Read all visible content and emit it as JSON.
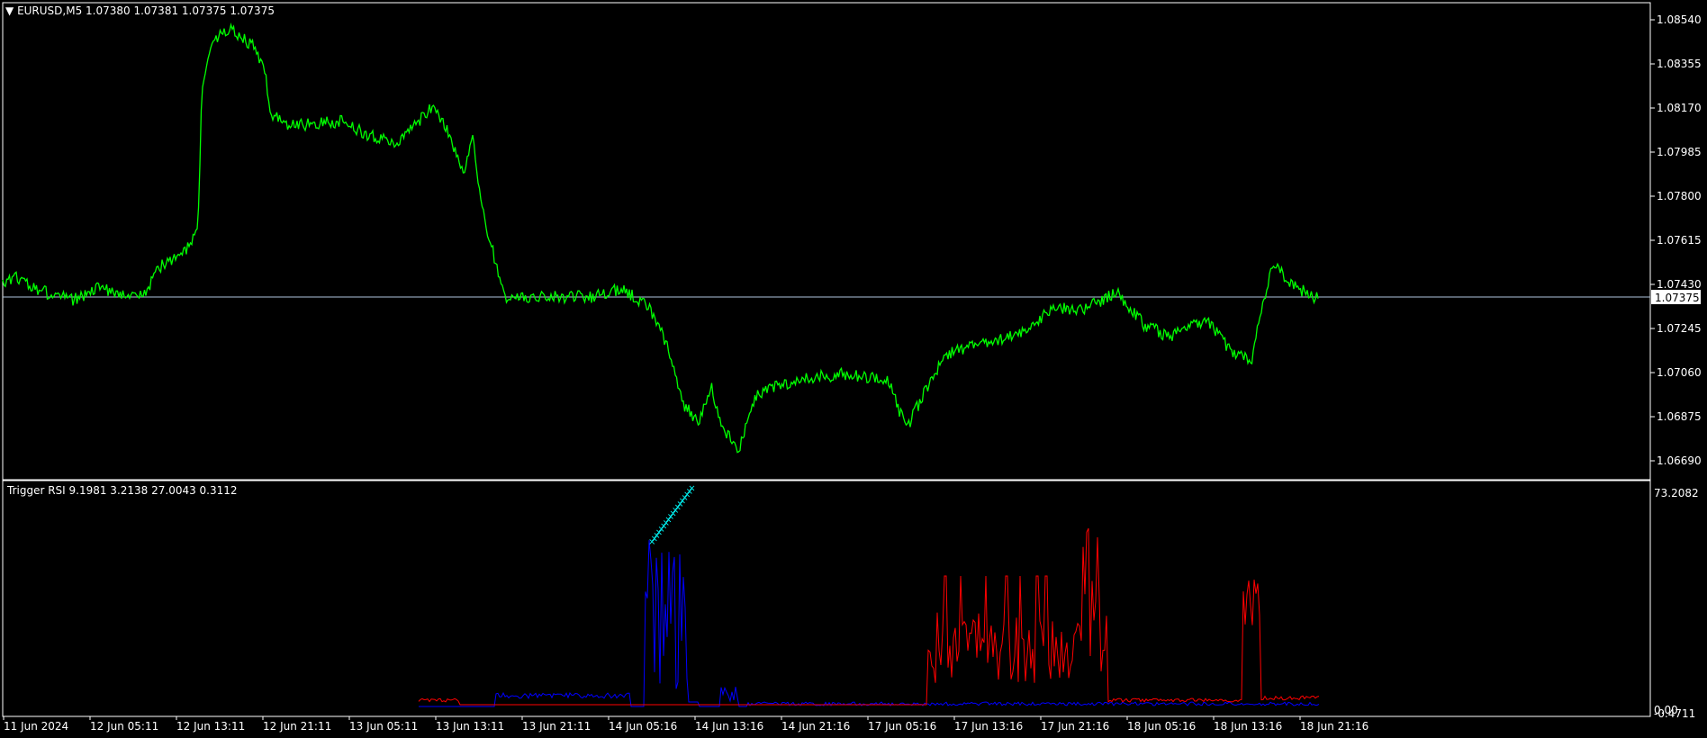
{
  "main_title": "EURUSD,M5  1.07380 1.07381 1.07375 1.07375",
  "indicator_title": "Trigger RSI 9.1981 3.2138 27.0043 0.3112",
  "current_price_label": "1.07375",
  "colors": {
    "background": "#000000",
    "frame": "#ffffff",
    "price": "#00ff00",
    "current_line": "#b0c4de",
    "rsi_red": "#ff0000",
    "rsi_blue": "#0000ff",
    "markers": "#00ffff"
  },
  "chart_data": [
    {
      "type": "line",
      "name": "price",
      "ylim": [
        1.066,
        1.086
      ],
      "y_ticks": [
        "1.08540",
        "1.08355",
        "1.08170",
        "1.07985",
        "1.07800",
        "1.07615",
        "1.07430",
        "1.07245",
        "1.07060",
        "1.06875",
        "1.06690"
      ],
      "current_value": 1.07375,
      "x_ticks": [
        "11 Jun 2024",
        "12 Jun 05:11",
        "12 Jun 13:11",
        "12 Jun 21:11",
        "13 Jun 05:11",
        "13 Jun 13:11",
        "13 Jun 21:11",
        "14 Jun 05:16",
        "14 Jun 13:16",
        "14 Jun 21:16",
        "17 Jun 05:16",
        "17 Jun 13:16",
        "17 Jun 21:16",
        "18 Jun 05:16",
        "18 Jun 13:16",
        "18 Jun 21:16"
      ],
      "x": [
        0,
        5,
        8,
        12,
        16,
        20,
        24,
        28,
        30,
        32,
        36,
        40,
        44,
        46,
        48,
        50,
        54,
        58,
        62,
        64,
        66,
        70,
        74,
        78,
        82,
        86,
        90,
        94,
        98,
        102,
        106,
        108,
        110,
        112,
        114,
        116,
        118,
        120,
        124,
        128,
        130,
        132,
        136,
        138,
        140,
        142,
        146,
        150,
        152,
        156,
        160,
        164,
        168,
        170,
        172,
        176,
        180,
        184,
        188,
        190,
        192,
        196,
        200,
        204,
        208,
        212,
        214,
        216,
        220,
        224,
        228,
        232,
        236,
        240,
        244,
        248,
        252,
        256,
        258,
        260,
        264,
        268,
        272,
        276,
        280,
        284,
        288,
        292,
        294,
        296,
        300,
        304,
        308,
        312,
        316,
        318,
        320,
        322,
        324,
        328,
        332,
        336,
        340,
        342,
        344,
        348,
        352,
        356,
        360,
        364,
        366,
        368,
        372,
        376,
        380,
        384,
        388,
        392,
        396,
        400,
        404,
        408,
        412,
        414,
        416,
        420,
        424,
        428,
        432,
        436,
        440,
        444,
        446,
        448,
        452,
        456,
        460,
        464,
        468,
        472,
        476,
        480,
        484,
        488,
        490,
        492,
        496,
        500,
        504,
        508,
        512,
        516,
        520,
        524,
        528,
        532,
        536,
        540,
        544,
        548,
        552,
        556,
        558,
        560,
        564,
        568,
        572,
        576,
        580,
        584,
        588,
        592,
        596,
        600,
        604,
        606,
        608,
        612,
        616,
        620,
        624,
        628,
        632,
        636,
        640,
        644,
        648,
        652,
        656,
        660,
        664,
        668,
        672,
        676,
        680,
        684,
        688,
        692,
        696,
        700,
        704,
        708,
        712,
        716,
        720,
        724,
        726,
        728,
        732,
        736,
        740,
        744,
        748,
        752,
        756,
        760,
        764,
        768,
        772,
        776,
        780,
        784,
        788,
        792,
        796,
        800,
        804,
        808,
        812,
        816,
        820,
        824,
        828,
        832,
        836,
        840,
        844,
        848,
        852,
        856,
        860,
        864,
        868,
        872,
        876,
        880,
        884,
        888,
        892,
        896,
        900,
        904,
        908,
        912,
        916,
        920,
        924,
        928,
        932,
        936,
        940,
        944,
        948,
        952,
        956,
        960,
        964,
        968,
        972,
        976,
        980,
        984,
        988,
        992,
        996,
        1000,
        1004,
        1008,
        1012,
        1016,
        1020,
        1024,
        1028,
        1032,
        1036,
        1040,
        1044,
        1048,
        1052,
        1056,
        1060,
        1064,
        1068,
        1072,
        1076,
        1080,
        1084,
        1088,
        1092,
        1096,
        1100,
        1104,
        1108,
        1112,
        1116,
        1120,
        1124,
        1128,
        1132,
        1136,
        1140,
        1144,
        1148,
        1152,
        1156,
        1160,
        1164,
        1168,
        1172,
        1176,
        1180,
        1184,
        1188,
        1192,
        1196,
        1200,
        1204,
        1208,
        1212,
        1216,
        1220,
        1224,
        1228,
        1232,
        1236,
        1240,
        1244,
        1248,
        1252,
        1256,
        1260,
        1264,
        1268,
        1272,
        1276,
        1280,
        1284,
        1288,
        1292,
        1296,
        1300,
        1304,
        1308,
        1312,
        1316,
        1320,
        1324,
        1328,
        1332,
        1336,
        1340,
        1344,
        1348,
        1352,
        1356,
        1360,
        1364,
        1368,
        1372,
        1376,
        1380,
        1384,
        1388,
        1392,
        1396,
        1400,
        1404,
        1408,
        1412,
        1416,
        1420,
        1424,
        1428,
        1432,
        1436,
        1440,
        1444,
        1448,
        1452,
        1456,
        1460,
        1464,
        1468,
        1470,
        1472,
        1474,
        1476,
        1480,
        1484,
        1488,
        1492,
        1496,
        1500,
        1504,
        1508,
        1512,
        1516,
        1520,
        1524,
        1528,
        1532,
        1536,
        1540,
        1544,
        1548,
        1552,
        1556,
        1560,
        1564,
        1568,
        1572,
        1576,
        1580,
        1584,
        1588,
        1592,
        1596,
        1600,
        1604,
        1608,
        1612,
        1616,
        1620,
        1624,
        1628,
        1632,
        1636,
        1640,
        1644,
        1648,
        1652,
        1656,
        1660,
        1664,
        1668,
        1672,
        1676,
        1680,
        1684,
        1688,
        1692,
        1696,
        1700,
        1704,
        1708,
        1712,
        1716,
        1720,
        1724,
        1728,
        1732,
        1736,
        1740,
        1744,
        1748,
        1752,
        1756,
        1760,
        1764,
        1768,
        1772,
        1776,
        1780,
        1784,
        1788,
        1792,
        1796,
        1800,
        1804,
        1808,
        1812,
        1816,
        1820,
        1824,
        1828,
        1832,
        1836,
        1840,
        1844,
        1848,
        1852,
        1856,
        1860,
        1864
      ],
      "y": []
    },
    {
      "type": "line",
      "name": "Trigger RSI",
      "ylim": [
        -0.4711,
        73.2082
      ],
      "y_ticks": [
        "73.2082",
        "0.00",
        "-0.4711"
      ],
      "values": [
        "9.1981",
        "3.2138",
        "27.0043",
        "0.3112"
      ]
    }
  ]
}
